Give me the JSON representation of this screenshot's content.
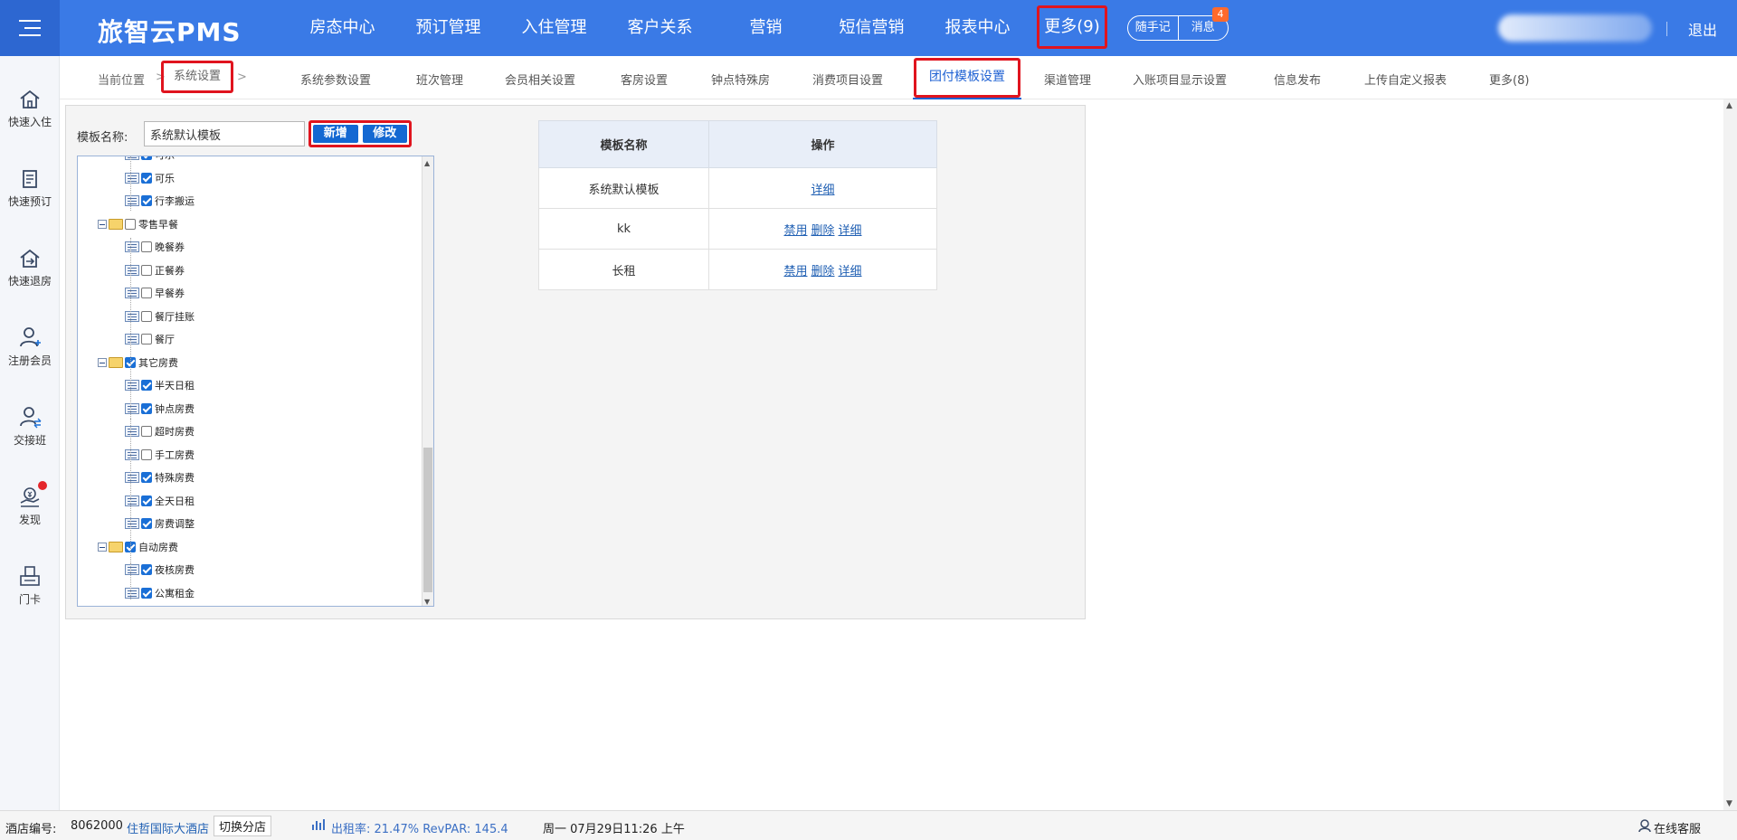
{
  "header": {
    "logo": "旅智云PMS",
    "nav": [
      "房态中心",
      "预订管理",
      "入住管理",
      "客户关系",
      "营销",
      "短信营销",
      "报表中心"
    ],
    "more": "更多(9)",
    "memo": "随手记",
    "messages": "消息",
    "message_count": "4",
    "logout": "退出"
  },
  "sidebar": {
    "items": [
      "快速入住",
      "快速预订",
      "快速退房",
      "注册会员",
      "交接班",
      "发现",
      "门卡"
    ]
  },
  "breadcrumb": {
    "label": "当前位置",
    "current": "系统设置",
    "arrow": ">"
  },
  "subtabs": {
    "items": [
      "系统参数设置",
      "班次管理",
      "会员相关设置",
      "客房设置",
      "钟点特殊房",
      "消费项目设置",
      "团付模板设置",
      "渠道管理",
      "入账项目显示设置",
      "信息发布",
      "上传自定义报表",
      "更多(8)"
    ],
    "active": "团付模板设置"
  },
  "form": {
    "template_label": "模板名称:",
    "template_value": "系统默认模板",
    "add": "新增",
    "edit": "修改"
  },
  "tree": {
    "rows": [
      {
        "label": "可乐",
        "type": "leaf",
        "checked": true
      },
      {
        "label": "可乐",
        "type": "leaf",
        "checked": true
      },
      {
        "label": "行李搬运",
        "type": "leaf",
        "checked": true
      },
      {
        "label": "零售早餐",
        "type": "folder",
        "checked": false
      },
      {
        "label": "晚餐券",
        "type": "leaf",
        "checked": false
      },
      {
        "label": "正餐券",
        "type": "leaf",
        "checked": false
      },
      {
        "label": "早餐券",
        "type": "leaf",
        "checked": false
      },
      {
        "label": "餐厅挂账",
        "type": "leaf",
        "checked": false
      },
      {
        "label": "餐厅",
        "type": "leaf",
        "checked": false
      },
      {
        "label": "其它房费",
        "type": "folder",
        "checked": true
      },
      {
        "label": "半天日租",
        "type": "leaf",
        "checked": true
      },
      {
        "label": "钟点房费",
        "type": "leaf",
        "checked": true
      },
      {
        "label": "超时房费",
        "type": "leaf",
        "checked": false
      },
      {
        "label": "手工房费",
        "type": "leaf",
        "checked": false
      },
      {
        "label": "特殊房费",
        "type": "leaf",
        "checked": true
      },
      {
        "label": "全天日租",
        "type": "leaf",
        "checked": true
      },
      {
        "label": "房费调整",
        "type": "leaf",
        "checked": true
      },
      {
        "label": "自动房费",
        "type": "folder",
        "checked": true
      },
      {
        "label": "夜核房费",
        "type": "leaf",
        "checked": true
      },
      {
        "label": "公寓租金",
        "type": "leaf",
        "checked": true
      }
    ]
  },
  "table": {
    "headers": [
      "模板名称",
      "操作"
    ],
    "rows": [
      {
        "name": "系统默认模板",
        "ops": [
          "详细"
        ]
      },
      {
        "name": "kk",
        "ops": [
          "禁用",
          "删除",
          "详细"
        ]
      },
      {
        "name": "长租",
        "ops": [
          "禁用",
          "删除",
          "详细"
        ]
      }
    ]
  },
  "footer": {
    "hotel_no_label": "酒店编号:",
    "hotel_no": "8062000",
    "hotel_name": "住哲国际大酒店",
    "switch": "切换分店",
    "stats": "出租率: 21.47% RevPAR: 145.4",
    "datetime": "周一 07月29日11:26 上午",
    "chat": "在线客服"
  },
  "colors": {
    "header_bg": "#3a7ae6",
    "highlight": "#e0141e",
    "active_tab": "#1f62d3",
    "button": "#1468d2"
  }
}
